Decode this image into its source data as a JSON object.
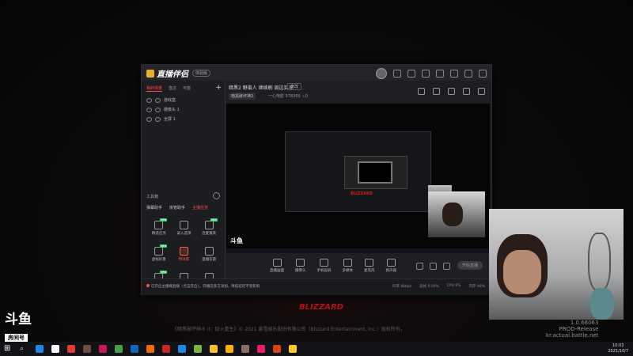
{
  "app": {
    "name": "直播伴侣",
    "badge": "体验版",
    "left_tabs": [
      "我的场景",
      "直达",
      "可能"
    ],
    "sources": [
      "游戏盒",
      "摄像头 1",
      "全屏 1"
    ],
    "tools_header": "工具箱",
    "tool_labels": [
      "弹幕助手",
      "房管助手",
      "主播任务"
    ],
    "tools": [
      {
        "label": "精选任务",
        "tag": "NEW"
      },
      {
        "label": "录入选项",
        "tag": ""
      },
      {
        "label": "连麦嘉宾",
        "tag": "NEW"
      },
      {
        "label": "虚拟形象",
        "tag": "NEW"
      },
      {
        "label": "特效库",
        "tag": ""
      },
      {
        "label": "直播答题",
        "tag": ""
      },
      {
        "label": "全民K歌",
        "tag": "NEW"
      },
      {
        "label": "本地推流",
        "tag": ""
      },
      {
        "label": "上车一起玩",
        "tag": ""
      }
    ],
    "stream_title": "暗黑2 野蛮人 继续刷 周边实况",
    "edit_label": "修改",
    "category": "暗黑破坏神2",
    "room_label": "一心电影",
    "room_number": "578300",
    "viewer_count": "0",
    "controls": [
      "直播画面",
      "摄像头",
      "手机投屏",
      "多媒体",
      "麦克风",
      "扬声器"
    ],
    "live_button": "开始直播",
    "status_message": "已开启主播端直播（点击开启），开播前多方添加，降低延迟不受影响",
    "status_stats": [
      "码率 0kbps",
      "丢帧 0.00%",
      "CPU 9%",
      "内存 48%"
    ]
  },
  "game": {
    "brand": "BLIZZARD",
    "copyright": "《暗黑破坏神® II：狱火重生》© 2021 暴雪娱乐股份有限公司（Blizzard Entertainment, Inc.）版权所有。",
    "version": "1.0.66063",
    "build": "PROD-Release",
    "server": "kr.actual.battle.net"
  },
  "douyu": {
    "logo": "斗鱼",
    "sub": "房间号",
    "room_id": "578300"
  },
  "taskbar": {
    "time": "10:03",
    "date": "2021/10/7",
    "icon_colors": [
      "#1e88e5",
      "#ffffff",
      "#e53935",
      "#6d4c41",
      "#c2185b",
      "#43a047",
      "#1565c0",
      "#ef6c00",
      "#c62828",
      "#1e88e5",
      "#7cb342",
      "#fbc02d",
      "#ffb300",
      "#8d6e63",
      "#e91e63",
      "#d84315",
      "#ffca28"
    ]
  }
}
